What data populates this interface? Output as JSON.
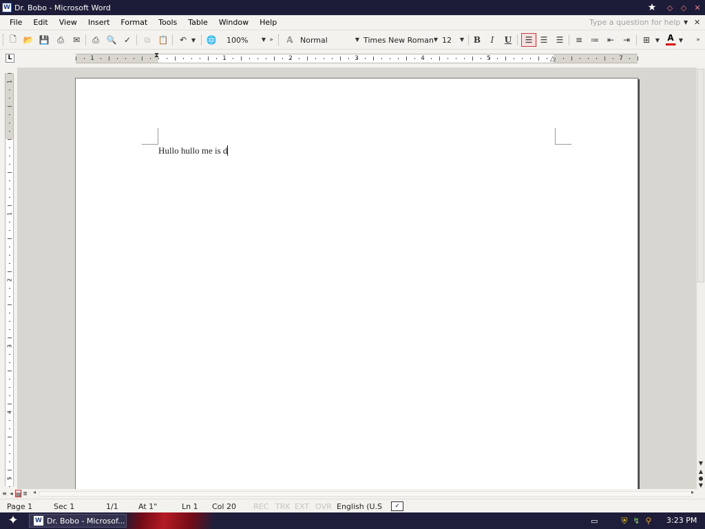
{
  "window": {
    "app_icon": "word-icon",
    "app_icon_glyph": "W",
    "title": "Dr. Bobo - Microsoft Word",
    "star_glyph": "★",
    "minimize_glyph": "◇",
    "maximize_glyph": "◇",
    "close_glyph": "✕"
  },
  "menu": {
    "items": [
      "File",
      "Edit",
      "View",
      "Insert",
      "Format",
      "Tools",
      "Table",
      "Window",
      "Help"
    ],
    "help_placeholder": "Type a question for help",
    "close_glyph": "✕"
  },
  "toolbar": {
    "zoom": "100%",
    "style": "Normal",
    "font": "Times New Roman",
    "font_size": "12",
    "bold": "B",
    "italic": "I",
    "underline": "U",
    "font_color_label": "A",
    "font_color": "#e00000"
  },
  "ruler": {
    "tab_selector": "L",
    "h_numbers": [
      "1",
      "1",
      "2",
      "3",
      "4",
      "5",
      "7"
    ],
    "v_numbers": [
      "1",
      "1",
      "2",
      "3",
      "4",
      "5"
    ]
  },
  "document": {
    "text": "Hullo hullo me is d"
  },
  "statusbar": {
    "page": "Page  1",
    "sec": "Sec  1",
    "pages": "1/1",
    "at": "At  1\"",
    "ln": "Ln  1",
    "col": "Col  20",
    "rec": "REC",
    "trk": "TRK",
    "ext": "EXT",
    "ovr": "OVR",
    "language": "English (U.S"
  },
  "taskbar": {
    "task_label": "Dr. Bobo - Microsof...",
    "clock": "3:23 PM"
  }
}
